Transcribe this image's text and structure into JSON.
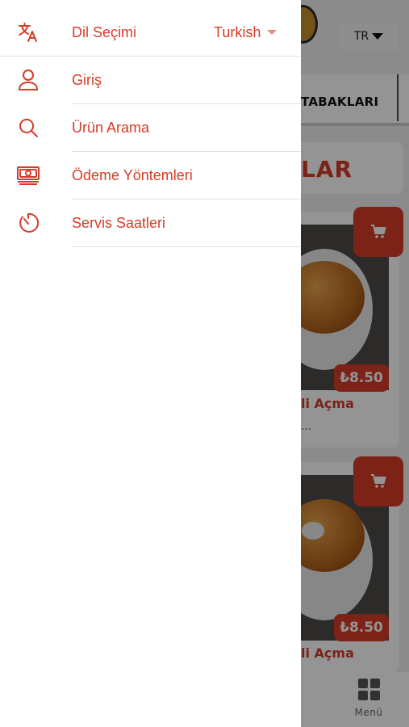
{
  "colors": {
    "accent": "#d63c28",
    "divider": "#e2e2e2",
    "drawer_bg": "#ffffff"
  },
  "drawer": {
    "language": {
      "icon": "translate-icon",
      "label": "Dil Seçimi",
      "selected": "Turkish"
    },
    "items": [
      {
        "icon": "user-icon",
        "label": "Giriş"
      },
      {
        "icon": "search-icon",
        "label": "Ürün Arama"
      },
      {
        "icon": "cash-icon",
        "label": "Ödeme Yöntemleri"
      },
      {
        "icon": "timer-icon",
        "label": "Servis Saatleri"
      }
    ]
  },
  "background": {
    "lang_button": "TR",
    "category_tab": "TABAKLARI",
    "section_title": "LAR",
    "products": [
      {
        "price": "₺8.50",
        "name": "li Açma",
        "desc": "..."
      },
      {
        "price": "₺8.50",
        "name": "li Açma"
      }
    ],
    "menu_label": "Menü"
  }
}
